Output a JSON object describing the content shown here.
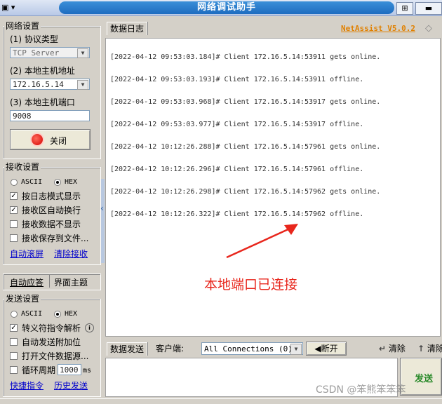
{
  "window": {
    "title": "网络调试助手",
    "brand": "NetAssist V5.0.2",
    "sysmenu_glyph": "▣ ▾",
    "btn_restore": "⊞",
    "btn_min": "▬"
  },
  "net_settings": {
    "title": "网络设置",
    "protocol_label": "(1) 协议类型",
    "protocol_value": "TCP Server",
    "host_label": "(2) 本地主机地址",
    "host_value": "172.16.5.14",
    "port_label": "(3) 本地主机端口",
    "port_value": "9008",
    "close_label": "关闭"
  },
  "recv_settings": {
    "title": "接收设置",
    "ascii": "ASCII",
    "hex": "HEX",
    "options": [
      "按日志模式显示",
      "接收区自动换行",
      "接收数据不显示",
      "接收保存到文件..."
    ],
    "link_auto_scroll": "自动滚屏",
    "link_clear": "清除接收"
  },
  "misc_tabs": {
    "auto_reply": "自动应答",
    "theme": "界面主题"
  },
  "send_settings": {
    "title": "发送设置",
    "ascii": "ASCII",
    "hex": "HEX",
    "options": [
      "转义符指令解析",
      "自动发送附加位",
      "打开文件数据源...",
      "循环周期"
    ],
    "period_value": "1000",
    "period_unit": "ms",
    "link_shortcut": "快捷指令",
    "link_history": "历史发送"
  },
  "log": {
    "tab": "数据日志",
    "lines": [
      "[2022-04-12 09:53:03.184]# Client 172.16.5.14:53911 gets online.",
      "[2022-04-12 09:53:03.193]# Client 172.16.5.14:53911 offline.",
      "[2022-04-12 09:53:03.968]# Client 172.16.5.14:53917 gets online.",
      "[2022-04-12 09:53:03.977]# Client 172.16.5.14:53917 offline.",
      "[2022-04-12 10:12:26.288]# Client 172.16.5.14:57961 gets online.",
      "[2022-04-12 10:12:26.296]# Client 172.16.5.14:57961 offline.",
      "[2022-04-12 10:12:26.298]# Client 172.16.5.14:57962 gets online.",
      "[2022-04-12 10:12:26.322]# Client 172.16.5.14:57962 offline."
    ],
    "annotation": "本地端口已连接",
    "annotation_color": "#e8261c"
  },
  "send_bar": {
    "tab": "数据发送",
    "client_label": "客户端:",
    "client_value": "All Connections (0)",
    "disconnect": "断开",
    "clear": "清除",
    "clear2": "清除",
    "send": "发送"
  },
  "watermark": "CSDN @笨熊笨笨笨"
}
